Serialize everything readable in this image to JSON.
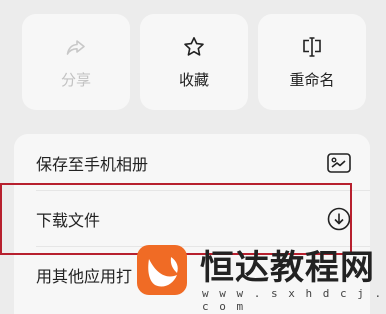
{
  "tiles": [
    {
      "label": "分享",
      "icon": "share-icon",
      "disabled": true
    },
    {
      "label": "收藏",
      "icon": "star-icon",
      "disabled": false
    },
    {
      "label": "重命名",
      "icon": "rename-icon",
      "disabled": false
    }
  ],
  "menu": {
    "save_to_album": "保存至手机相册",
    "download_file": "下载文件",
    "open_with_other_app": "用其他应用打"
  },
  "watermark": {
    "brand": "恒达教程网",
    "url": "w w w . s x h d c j . c o m"
  },
  "colors": {
    "highlight": "#b7202e",
    "watermark_logo": "#f06b25",
    "disabled_text": "#c2c2c2"
  }
}
